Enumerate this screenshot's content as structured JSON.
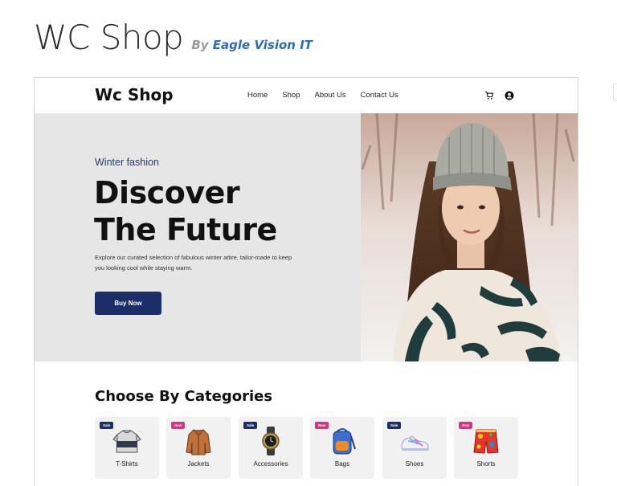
{
  "page": {
    "title": "WC Shop",
    "by_prefix": "By",
    "author": "Eagle Vision IT"
  },
  "site": {
    "brand": "Wc Shop",
    "menu": [
      "Home",
      "Shop",
      "About Us",
      "Contact Us"
    ],
    "icons": [
      "cart-icon",
      "user-account-icon"
    ]
  },
  "hero": {
    "kicker": "Winter fashion",
    "title_line1": "Discover",
    "title_line2": "The Future",
    "description": "Explore our curated selection of fabulous winter attire, tailor-made to keep you looking cool while staying warm.",
    "button_label": "Buy Now"
  },
  "categories": {
    "heading": "Choose By Categories",
    "items": [
      {
        "label": "T-Shirts",
        "badge": "Sale",
        "badge_color": "#1c2e6a",
        "icon": "tshirt-icon"
      },
      {
        "label": "Jackets",
        "badge": "New",
        "badge_color": "#e0307f",
        "icon": "jacket-icon"
      },
      {
        "label": "Accessories",
        "badge": "Sale",
        "badge_color": "#1c2e6a",
        "icon": "watch-icon"
      },
      {
        "label": "Bags",
        "badge": "New",
        "badge_color": "#e0307f",
        "icon": "backpack-icon"
      },
      {
        "label": "Shoes",
        "badge": "Sale",
        "badge_color": "#1c2e6a",
        "icon": "shoe-icon"
      },
      {
        "label": "Shorts",
        "badge": "New",
        "badge_color": "#e0307f",
        "icon": "shorts-icon"
      }
    ]
  },
  "colors": {
    "accent": "#1c2e6a",
    "new_badge": "#e0307f",
    "hero_bg": "#e6e6e6",
    "author_link": "#2f6db5"
  }
}
